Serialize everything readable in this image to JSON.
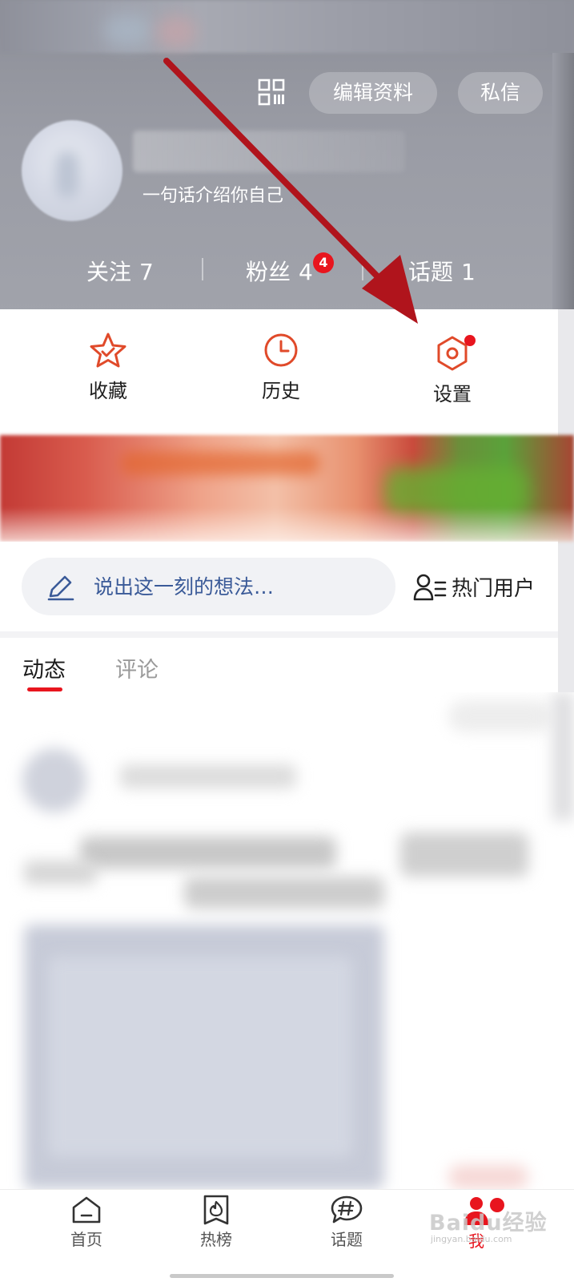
{
  "header": {
    "edit_profile_label": "编辑资料",
    "message_label": "私信",
    "bio": "一句话介绍你自己",
    "stats": {
      "follow_label": "关注",
      "follow_count": "7",
      "fans_label": "粉丝",
      "fans_count": "4",
      "fans_badge": "4",
      "topics_label": "话题",
      "topics_count": "1"
    }
  },
  "shortcuts": {
    "favorites": "收藏",
    "history": "历史",
    "settings": "设置"
  },
  "post_bar": {
    "placeholder": "说出这一刻的想法…",
    "hot_users": "热门用户"
  },
  "tabs": {
    "active": "动态",
    "inactive": "评论"
  },
  "bottom_nav": {
    "home": "首页",
    "hot": "热榜",
    "topics": "话题",
    "me": "我"
  },
  "watermark": {
    "main": "Baidu经验",
    "sub": "jingyan.baidu.com"
  },
  "colors": {
    "accent": "#e8151e",
    "annotation_arrow": "#b0141c",
    "placeholder_text": "#3a5a98"
  },
  "icons": [
    "qr-code-icon",
    "star-icon",
    "clock-icon",
    "hexagon-gear-icon",
    "pencil-icon",
    "user-list-icon",
    "home-icon",
    "flame-tag-icon",
    "hashtag-icon",
    "me-icon"
  ]
}
